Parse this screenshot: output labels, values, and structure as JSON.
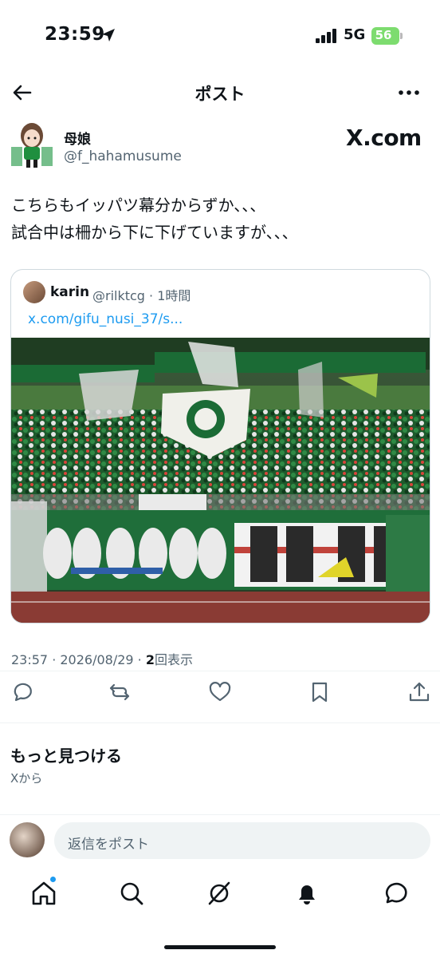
{
  "status_bar": {
    "time": "23:59",
    "network": "5G",
    "battery": "56"
  },
  "nav": {
    "title": "ポスト"
  },
  "author": {
    "name": "母娘",
    "handle": "@f_hahamusume",
    "badge": "X.com"
  },
  "post": {
    "lines": [
      "こちらもイッパツ幕分からずか、、、",
      "試合中は柵から下に下げていますが、、、"
    ],
    "timestamp": "23:57 · 2026/08/29 · ",
    "views_count": "2",
    "views_label": "回表示"
  },
  "quote": {
    "name": "karin",
    "handle_time": "@rilktcg · 1時間",
    "link": "x.com/gifu_nusi_37/s..."
  },
  "discover": {
    "title": "もっと見つける",
    "subtitle": "Xから"
  },
  "reply": {
    "placeholder": "返信をポスト"
  },
  "colors": {
    "accent": "#1d9bf0",
    "text": "#0f1419",
    "muted": "#536471",
    "battery": "#7ddc6f"
  }
}
